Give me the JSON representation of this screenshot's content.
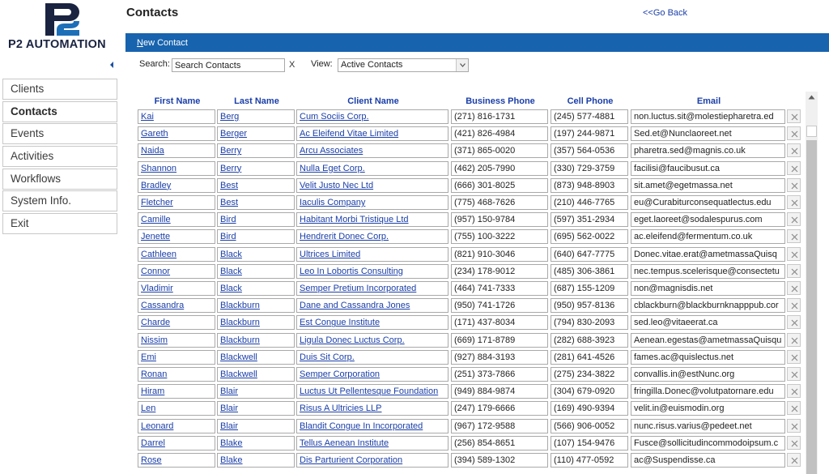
{
  "app": {
    "logo_text": "P2 AUTOMATION"
  },
  "sidebar": {
    "items": [
      {
        "label": "Clients",
        "active": false
      },
      {
        "label": "Contacts",
        "active": true
      },
      {
        "label": "Events",
        "active": false
      },
      {
        "label": "Activities",
        "active": false
      },
      {
        "label": "Workflows",
        "active": false
      },
      {
        "label": "System Info.",
        "active": false
      },
      {
        "label": "Exit",
        "active": false
      }
    ]
  },
  "header": {
    "title": "Contacts",
    "back_label": "<<Go Back"
  },
  "toolbar": {
    "new_contact_first": "N",
    "new_contact_rest": "ew Contact"
  },
  "filters": {
    "search_label": "Search:",
    "search_value": "Search Contacts",
    "clear_label": "X",
    "view_label": "View:",
    "view_value": "Active Contacts"
  },
  "table": {
    "columns": [
      "First Name",
      "Last Name",
      "Client Name",
      "Business Phone",
      "Cell Phone",
      "Email"
    ],
    "rows": [
      [
        "Kai",
        "Berg",
        "Cum Sociis Corp.",
        "(271) 816-1731",
        "(245) 577-4881",
        "non.luctus.sit@molestiepharetra.ed"
      ],
      [
        "Gareth",
        "Berger",
        "Ac Eleifend Vitae Limited",
        "(421) 826-4984",
        "(197) 244-9871",
        "Sed.et@Nunclaoreet.net"
      ],
      [
        "Naida",
        "Berry",
        "Arcu Associates",
        "(371) 865-0020",
        "(357) 564-0536",
        "pharetra.sed@magnis.co.uk"
      ],
      [
        "Shannon",
        "Berry",
        "Nulla Eget Corp.",
        "(462) 205-7990",
        "(330) 729-3759",
        "facilisi@faucibusut.ca"
      ],
      [
        "Bradley",
        "Best",
        "Velit Justo Nec Ltd",
        "(666) 301-8025",
        "(873) 948-8903",
        "sit.amet@egetmassa.net"
      ],
      [
        "Fletcher",
        "Best",
        "Iaculis Company",
        "(775) 468-7626",
        "(210) 446-7765",
        "eu@Curabiturconsequatlectus.edu"
      ],
      [
        "Camille",
        "Bird",
        "Habitant Morbi Tristique Ltd",
        "(957) 150-9784",
        "(597) 351-2934",
        "eget.laoreet@sodalespurus.com"
      ],
      [
        "Jenette",
        "Bird",
        "Hendrerit Donec Corp.",
        "(755) 100-3222",
        "(695) 562-0022",
        "ac.eleifend@fermentum.co.uk"
      ],
      [
        "Cathleen",
        "Black",
        "Ultrices Limited",
        "(821) 910-3046",
        "(640) 647-7775",
        "Donec.vitae.erat@ametmassaQuisq"
      ],
      [
        "Connor",
        "Black",
        "Leo In Lobortis Consulting",
        "(234) 178-9012",
        "(485) 306-3861",
        "nec.tempus.scelerisque@consectetu"
      ],
      [
        "Vladimir",
        "Black",
        "Semper Pretium Incorporated",
        "(464) 741-7333",
        "(687) 155-1209",
        "non@magnisdis.net"
      ],
      [
        "Cassandra",
        "Blackburn",
        "Dane and Cassandra Jones",
        "(950) 741-1726",
        "(950) 957-8136",
        "cblackburn@blackburnknapppub.cor"
      ],
      [
        "Charde",
        "Blackburn",
        "Est Congue Institute",
        "(171) 437-8034",
        "(794) 830-2093",
        "sed.leo@vitaeerat.ca"
      ],
      [
        "Nissim",
        "Blackburn",
        "Ligula Donec Luctus Corp.",
        "(669) 171-8789",
        "(282) 688-3923",
        "Aenean.egestas@ametmassaQuisqu"
      ],
      [
        "Emi",
        "Blackwell",
        "Duis Sit Corp.",
        "(927) 884-3193",
        "(281) 641-4526",
        "fames.ac@quislectus.net"
      ],
      [
        "Ronan",
        "Blackwell",
        "Semper Corporation",
        "(251) 373-7866",
        "(275) 234-3822",
        "convallis.in@estNunc.org"
      ],
      [
        "Hiram",
        "Blair",
        "Luctus Ut Pellentesque Foundation",
        "(949) 884-9874",
        "(304) 679-0920",
        "fringilla.Donec@volutpatornare.edu"
      ],
      [
        "Len",
        "Blair",
        "Risus A Ultricies LLP",
        "(247) 179-6666",
        "(169) 490-9394",
        "velit.in@euismodin.org"
      ],
      [
        "Leonard",
        "Blair",
        "Blandit Congue In Incorporated",
        "(967) 172-9588",
        "(566) 906-0052",
        "nunc.risus.varius@pedeet.net"
      ],
      [
        "Darrel",
        "Blake",
        "Tellus Aenean Institute",
        "(256) 854-8651",
        "(107) 154-9476",
        "Fusce@sollicitudincommodoipsum.c"
      ],
      [
        "Rose",
        "Blake",
        "Dis Parturient Corporation",
        "(394) 589-1302",
        "(110) 477-0592",
        "ac@Suspendisse.ca"
      ]
    ]
  }
}
